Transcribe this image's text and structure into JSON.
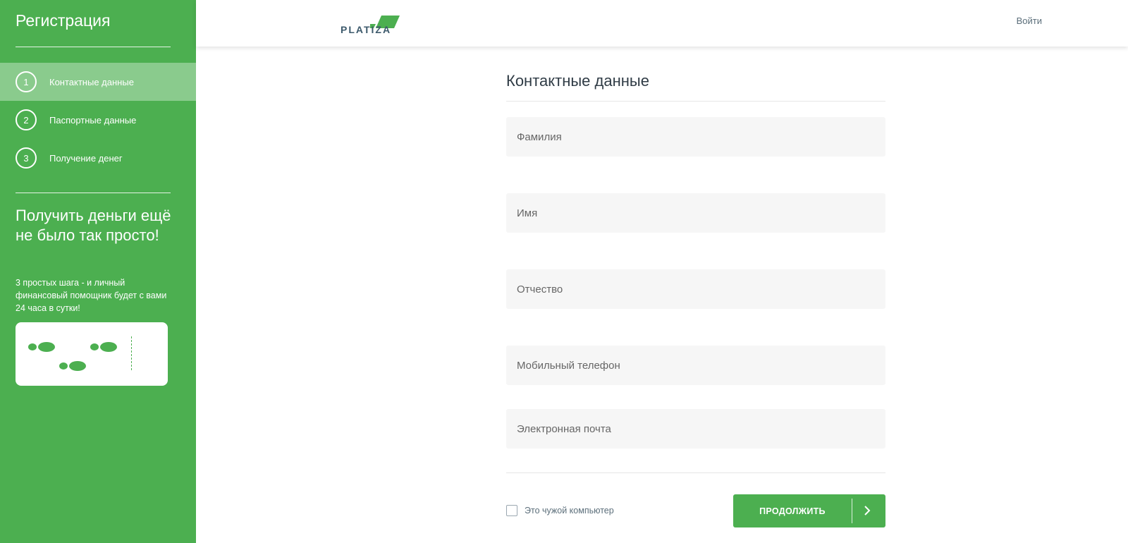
{
  "sidebar": {
    "title": "Регистрация",
    "steps": [
      {
        "num": "1",
        "label": "Контактные данные"
      },
      {
        "num": "2",
        "label": "Паспортные данные"
      },
      {
        "num": "3",
        "label": "Получение денег"
      }
    ],
    "promo": {
      "title": "Получить деньги ещё не было так просто!",
      "text": "3 простых шага - и личный финансовый помощник будет с вами 24 часа в сутки!"
    }
  },
  "header": {
    "logo_text": "PLATIZA",
    "login_label": "Войти"
  },
  "form": {
    "title": "Контактные данные",
    "fields": {
      "surname": {
        "placeholder": "Фамилия",
        "value": ""
      },
      "name": {
        "placeholder": "Имя",
        "value": ""
      },
      "patronymic": {
        "placeholder": "Отчество",
        "value": ""
      },
      "phone": {
        "placeholder": "Мобильный телефон",
        "value": ""
      },
      "email": {
        "placeholder": "Электронная почта",
        "value": ""
      }
    },
    "checkbox_label": "Это чужой компьютер",
    "continue_label": "ПРОДОЛЖИТЬ"
  },
  "colors": {
    "accent": "#4caf50",
    "field_bg": "#f6f6f6",
    "logo_dark": "#3d5a6c"
  }
}
